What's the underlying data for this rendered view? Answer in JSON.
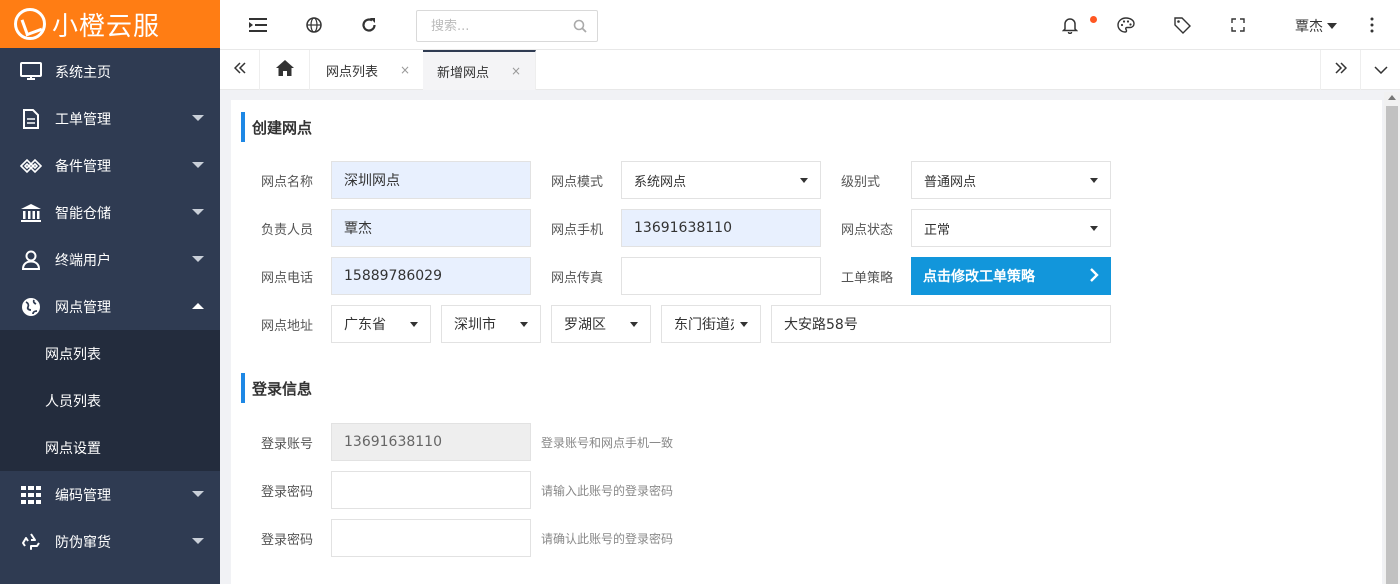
{
  "brand": {
    "name": "小橙云服"
  },
  "sidebar": {
    "items": [
      {
        "label": "系统主页",
        "icon": "monitor-icon"
      },
      {
        "label": "工单管理",
        "icon": "document-icon"
      },
      {
        "label": "备件管理",
        "icon": "diamond-link-icon"
      },
      {
        "label": "智能仓储",
        "icon": "bank-icon"
      },
      {
        "label": "终端用户",
        "icon": "user-icon"
      },
      {
        "label": "网点管理",
        "icon": "globe-icon"
      },
      {
        "label": "编码管理",
        "icon": "grid-icon"
      },
      {
        "label": "防伪窜货",
        "icon": "recycle-icon"
      }
    ],
    "submenu": [
      "网点列表",
      "人员列表",
      "网点设置"
    ]
  },
  "topbar": {
    "search_placeholder": "搜索...",
    "user": "覃杰"
  },
  "tabs": [
    {
      "label": "网点列表",
      "close": "×"
    },
    {
      "label": "新增网点",
      "close": "×"
    }
  ],
  "form": {
    "section1_title": "创建网点",
    "section2_title": "登录信息",
    "labels": {
      "name": "网点名称",
      "mode": "网点模式",
      "level": "级别式",
      "manager": "负责人员",
      "phone": "网点手机",
      "status": "网点状态",
      "tel": "网点电话",
      "fax": "网点传真",
      "strategy": "工单策略",
      "address": "网点地址",
      "account": "登录账号",
      "password": "登录密码",
      "password_confirm": "登录密码"
    },
    "values": {
      "name": "深圳网点",
      "mode": "系统网点",
      "level": "普通网点",
      "manager": "覃杰",
      "phone": "13691638110",
      "status": "正常",
      "tel": "15889786029",
      "fax": "",
      "strategy_button": "点击修改工单策略",
      "province": "广东省",
      "city": "深圳市",
      "district": "罗湖区",
      "street": "东门街道办",
      "detail_address": "大安路58号",
      "account": "13691638110"
    },
    "hints": {
      "account": "登录账号和网点手机一致",
      "password": "请输入此账号的登录密码",
      "password_confirm": "请确认此账号的登录密码"
    }
  }
}
